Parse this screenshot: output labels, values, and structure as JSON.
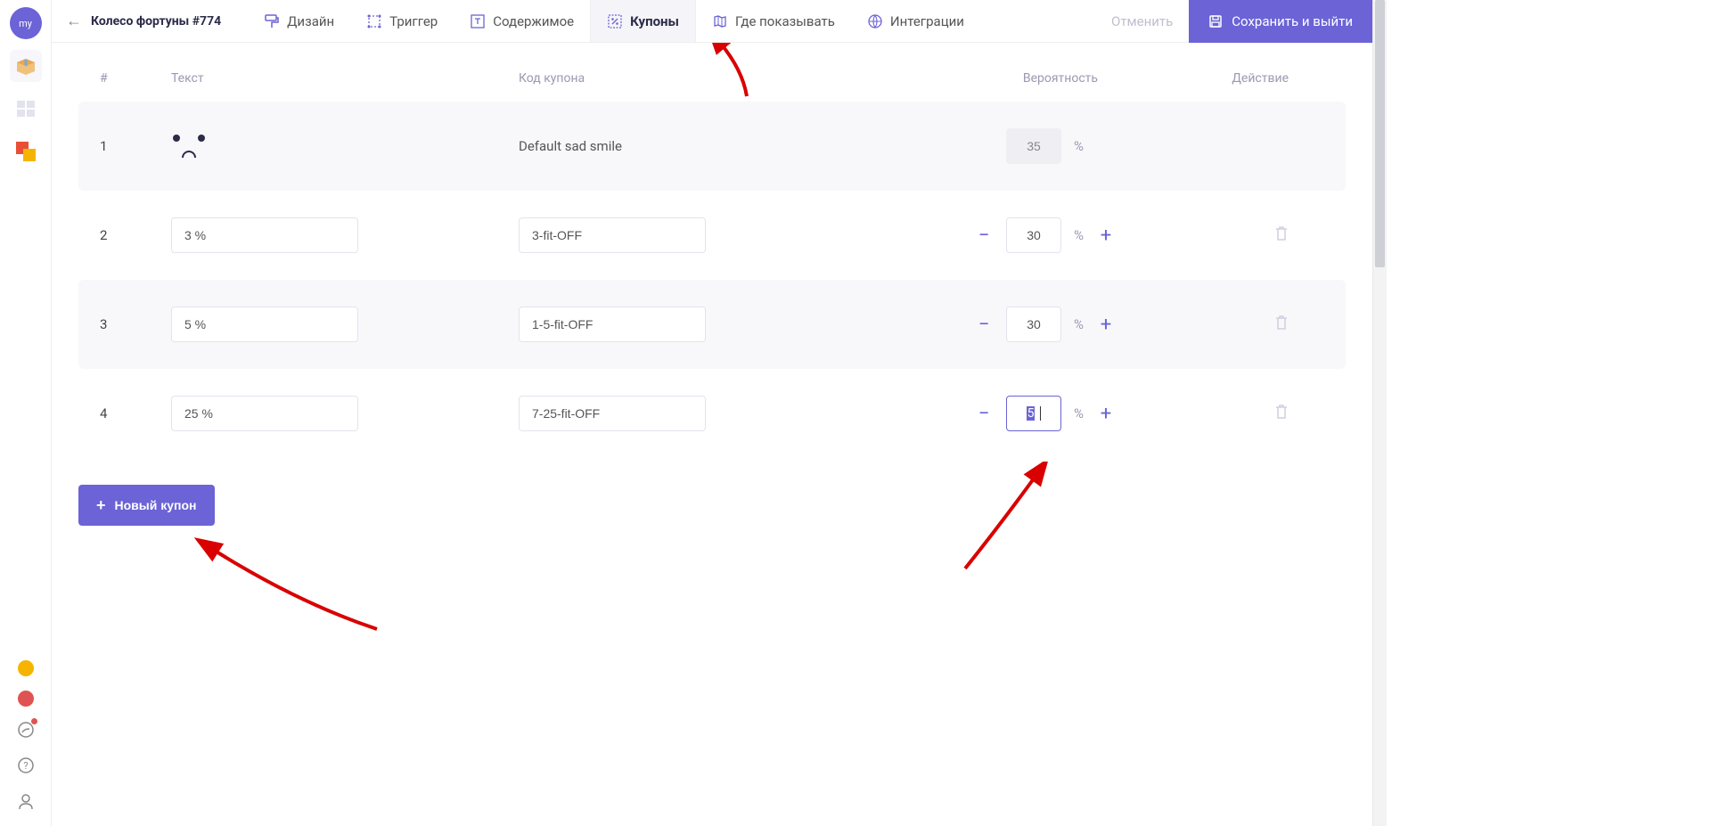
{
  "avatar_text": "my",
  "page_title": "Колесо фортуны #774",
  "tabs": {
    "design": "Дизайн",
    "trigger": "Триггер",
    "content": "Содержимое",
    "coupons": "Купоны",
    "where": "Где показывать",
    "integrations": "Интеграции"
  },
  "actions": {
    "cancel": "Отменить",
    "save": "Сохранить и выйти"
  },
  "columns": {
    "num": "#",
    "text": "Текст",
    "code": "Код купона",
    "prob": "Вероятность",
    "act": "Действие"
  },
  "pct_sign": "%",
  "rows": [
    {
      "n": "1",
      "text": "",
      "code": "Default sad smile",
      "prob": "35",
      "readonly": true
    },
    {
      "n": "2",
      "text": "3 %",
      "code": "3-fit-OFF",
      "prob": "30",
      "readonly": false
    },
    {
      "n": "3",
      "text": "5 %",
      "code": "1-5-fit-OFF",
      "prob": "30",
      "readonly": false
    },
    {
      "n": "4",
      "text": "25 %",
      "code": "7-25-fit-OFF",
      "prob": "5",
      "readonly": false,
      "focused": true
    }
  ],
  "new_coupon": "Новый купон"
}
